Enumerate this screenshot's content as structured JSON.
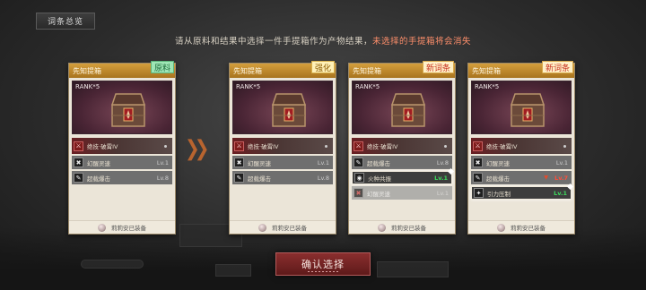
{
  "header": {
    "tab_label": "词条总览",
    "instruction_main": "请从原料和结果中选择一件手提箱作为产物结果，",
    "instruction_warn": "未选择的手提箱将会消失"
  },
  "cards": [
    {
      "title": "先知提箱",
      "tag": "原料",
      "tag_style": "green",
      "rank": "RANK*5",
      "rows": [
        {
          "label": "绝技·破霄IV",
          "lv": "",
          "kind": "main",
          "icon": "skill-icon"
        },
        {
          "label": "幻醒灵速",
          "lv": "Lv.1",
          "kind": "norm",
          "icon": "cross-icon"
        },
        {
          "label": "超载爆击",
          "lv": "Lv.8",
          "kind": "norm",
          "icon": "burst-icon"
        }
      ],
      "footer": "莉莉安已装备"
    },
    {
      "title": "先知提箱",
      "tag": "强化",
      "tag_style": "yellow",
      "rank": "RANK*5",
      "rows": [
        {
          "label": "绝技·破霄IV",
          "lv": "",
          "kind": "main",
          "icon": "skill-icon"
        },
        {
          "label": "幻醒灵速",
          "lv": "Lv.1",
          "kind": "norm",
          "icon": "cross-icon"
        },
        {
          "label": "超载爆击",
          "lv": "Lv.8",
          "kind": "norm",
          "icon": "burst-icon"
        }
      ],
      "footer": "莉莉安已装备"
    },
    {
      "title": "先知提箱",
      "tag": "新词条",
      "tag_style": "red",
      "rank": "RANK*5",
      "rows": [
        {
          "label": "绝技·破霄IV",
          "lv": "",
          "kind": "main",
          "icon": "skill-icon"
        },
        {
          "label": "超载爆击",
          "lv": "Lv.8",
          "kind": "norm",
          "icon": "burst-icon"
        },
        {
          "label": "火种共振",
          "lv": "Lv.1",
          "kind": "hi",
          "icon": "resonance-icon"
        },
        {
          "label": "幻醒灵速",
          "lv": "Lv.1",
          "kind": "dim",
          "icon": "cross-icon"
        }
      ],
      "footer": "莉莉安已装备"
    },
    {
      "title": "先知提箱",
      "tag": "新词条",
      "tag_style": "red",
      "rank": "RANK*5",
      "rows": [
        {
          "label": "绝技·破霄IV",
          "lv": "",
          "kind": "main",
          "icon": "skill-icon"
        },
        {
          "label": "幻醒灵速",
          "lv": "Lv.1",
          "kind": "norm",
          "icon": "cross-icon"
        },
        {
          "label": "超载爆击",
          "lv": "Lv.7",
          "kind": "norm-down",
          "icon": "burst-icon"
        },
        {
          "label": "引力压制",
          "lv": "Lv.1",
          "kind": "hi",
          "icon": "gravity-icon"
        }
      ],
      "footer": "莉莉安已装备"
    }
  ],
  "confirm_label": "确认选择",
  "colors": {
    "accent_orange": "#d49e3c",
    "confirm_red": "#8a2e2e",
    "level_green": "#3ddb5d",
    "warn_text": "#ff8f6b"
  }
}
